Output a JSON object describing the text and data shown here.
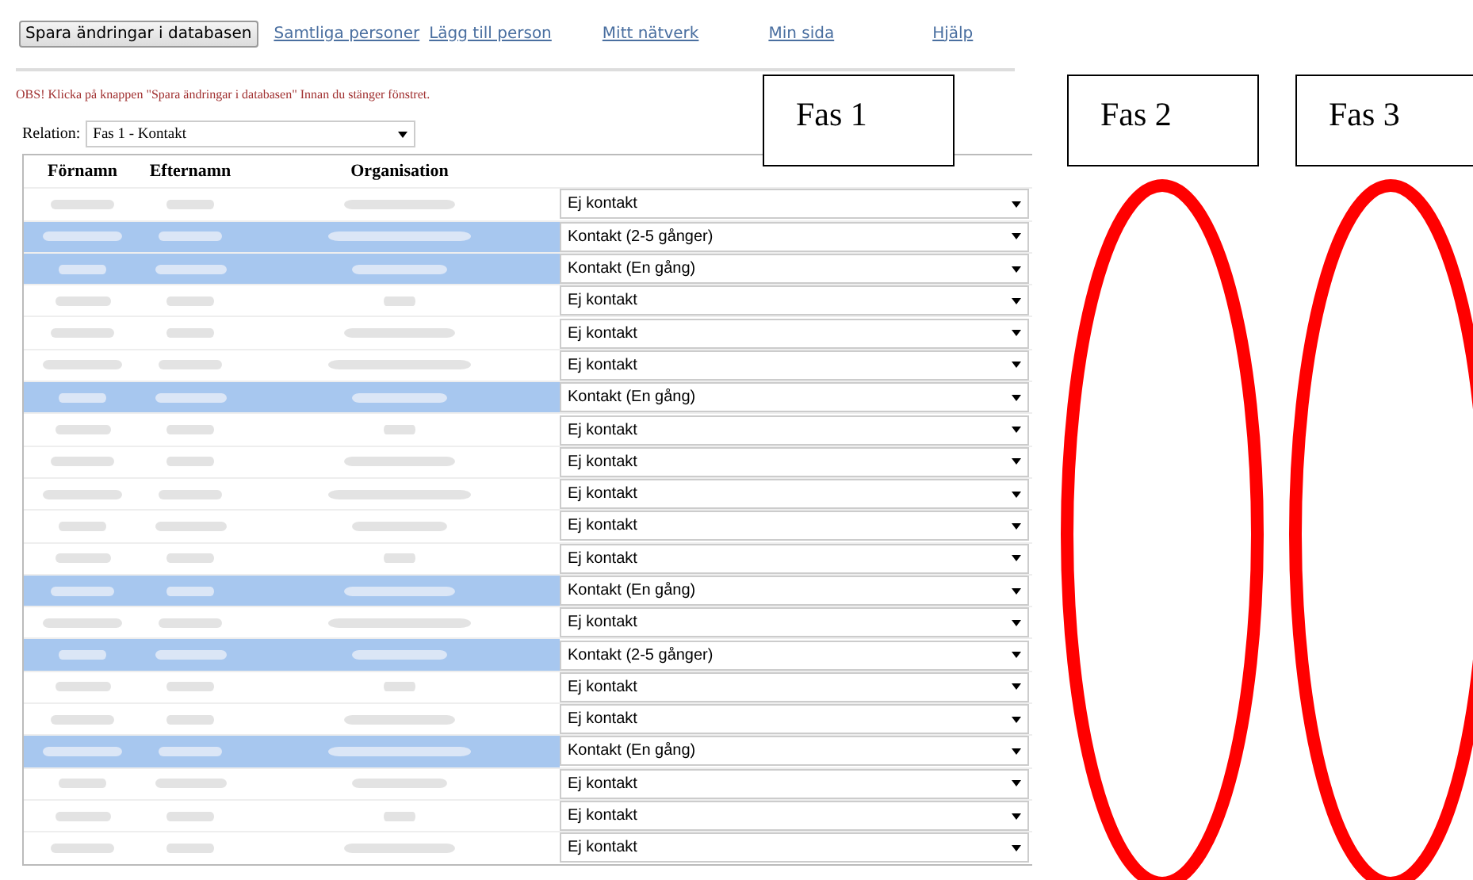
{
  "toolbar": {
    "save_button": "Spara ändringar i databasen",
    "links": [
      "Samtliga personer",
      "Lägg till person",
      "Mitt nätverk",
      "Min sida",
      "Hjälp"
    ]
  },
  "warning": "OBS! Klicka på knappen \"Spara ändringar i databasen\" Innan du stänger fönstret.",
  "relation": {
    "label": "Relation:",
    "value": "Fas 1 - Kontakt"
  },
  "table": {
    "columns": [
      "Förnamn",
      "Efternamn",
      "Organisation"
    ],
    "rows": [
      {
        "selected": false,
        "contact": "Ej kontakt"
      },
      {
        "selected": true,
        "contact": "Kontakt (2-5 gånger)"
      },
      {
        "selected": true,
        "contact": "Kontakt (En gång)"
      },
      {
        "selected": false,
        "contact": "Ej kontakt"
      },
      {
        "selected": false,
        "contact": "Ej kontakt"
      },
      {
        "selected": false,
        "contact": "Ej kontakt"
      },
      {
        "selected": true,
        "contact": "Kontakt (En gång)"
      },
      {
        "selected": false,
        "contact": "Ej kontakt"
      },
      {
        "selected": false,
        "contact": "Ej kontakt"
      },
      {
        "selected": false,
        "contact": "Ej kontakt"
      },
      {
        "selected": false,
        "contact": "Ej kontakt"
      },
      {
        "selected": false,
        "contact": "Ej kontakt"
      },
      {
        "selected": true,
        "contact": "Kontakt (En gång)"
      },
      {
        "selected": false,
        "contact": "Ej kontakt"
      },
      {
        "selected": true,
        "contact": "Kontakt (2-5 gånger)"
      },
      {
        "selected": false,
        "contact": "Ej kontakt"
      },
      {
        "selected": false,
        "contact": "Ej kontakt"
      },
      {
        "selected": true,
        "contact": "Kontakt (En gång)"
      },
      {
        "selected": false,
        "contact": "Ej kontakt"
      },
      {
        "selected": false,
        "contact": "Ej kontakt"
      },
      {
        "selected": false,
        "contact": "Ej kontakt"
      }
    ]
  },
  "annotations": [
    {
      "label": "Fas 1",
      "kind": "box"
    },
    {
      "label": "Fas 2",
      "kind": "circled"
    },
    {
      "label": "Fas 3",
      "kind": "circled"
    }
  ]
}
